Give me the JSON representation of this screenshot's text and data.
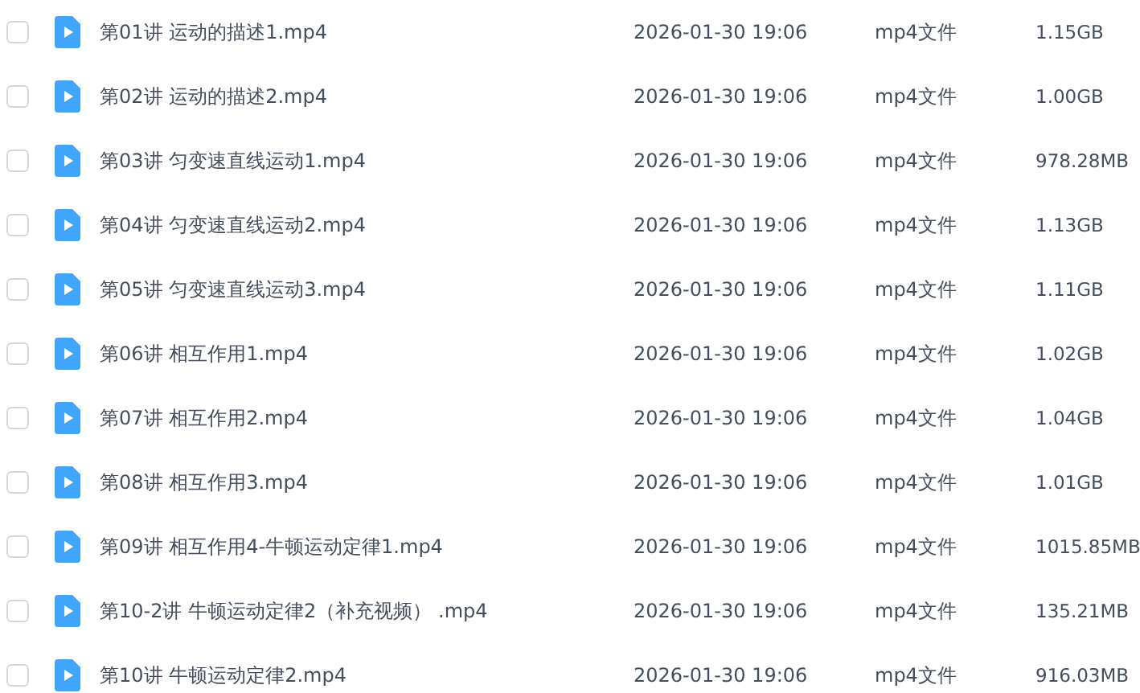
{
  "files": [
    {
      "name": "第01讲 运动的描述1.mp4",
      "modified": "2026-01-30 19:06",
      "type": "mp4文件",
      "size": "1.15GB",
      "checked": false
    },
    {
      "name": "第02讲 运动的描述2.mp4",
      "modified": "2026-01-30 19:06",
      "type": "mp4文件",
      "size": "1.00GB",
      "checked": false
    },
    {
      "name": "第03讲 匀变速直线运动1.mp4",
      "modified": "2026-01-30 19:06",
      "type": "mp4文件",
      "size": "978.28MB",
      "checked": false
    },
    {
      "name": "第04讲 匀变速直线运动2.mp4",
      "modified": "2026-01-30 19:06",
      "type": "mp4文件",
      "size": "1.13GB",
      "checked": false
    },
    {
      "name": "第05讲 匀变速直线运动3.mp4",
      "modified": "2026-01-30 19:06",
      "type": "mp4文件",
      "size": "1.11GB",
      "checked": false
    },
    {
      "name": "第06讲 相互作用1.mp4",
      "modified": "2026-01-30 19:06",
      "type": "mp4文件",
      "size": "1.02GB",
      "checked": false
    },
    {
      "name": "第07讲 相互作用2.mp4",
      "modified": "2026-01-30 19:06",
      "type": "mp4文件",
      "size": "1.04GB",
      "checked": false
    },
    {
      "name": "第08讲 相互作用3.mp4",
      "modified": "2026-01-30 19:06",
      "type": "mp4文件",
      "size": "1.01GB",
      "checked": false
    },
    {
      "name": "第09讲 相互作用4-牛顿运动定律1.mp4",
      "modified": "2026-01-30 19:06",
      "type": "mp4文件",
      "size": "1015.85MB",
      "checked": false
    },
    {
      "name": "第10-2讲 牛顿运动定律2（补充视频） .mp4",
      "modified": "2026-01-30 19:06",
      "type": "mp4文件",
      "size": "135.21MB",
      "checked": false
    },
    {
      "name": "第10讲 牛顿运动定律2.mp4",
      "modified": "2026-01-30 19:06",
      "type": "mp4文件",
      "size": "916.03MB",
      "checked": false
    }
  ]
}
